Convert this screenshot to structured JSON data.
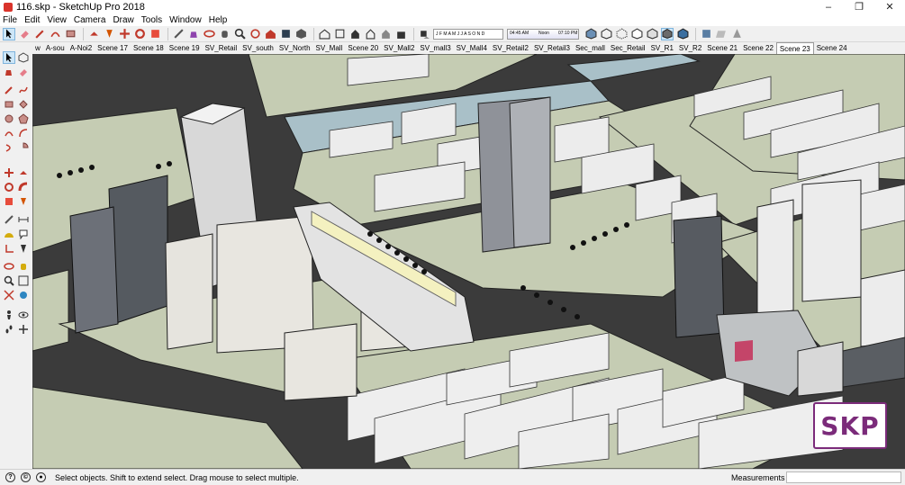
{
  "window": {
    "title": "116.skp - SketchUp Pro 2018",
    "minimize": "–",
    "maximize": "❐",
    "close": "✕"
  },
  "menu": [
    "File",
    "Edit",
    "View",
    "Camera",
    "Draw",
    "Tools",
    "Window",
    "Help"
  ],
  "toolbar": {
    "shadow_months": "J F M A M J J A S O N D",
    "time_start": "04:45 AM",
    "time_noon": "Noon",
    "time_end": "07:10 PM"
  },
  "scenes": [
    "w",
    "A-sou",
    "A-Noi2",
    "Scene 17",
    "Scene 18",
    "Scene 19",
    "SV_Retail",
    "SV_south",
    "SV_North",
    "SV_Mall",
    "Scene 20",
    "SV_Mall2",
    "SV_mall3",
    "SV_Mall4",
    "SV_Retail2",
    "SV_Retail3",
    "Sec_mall",
    "Sec_Retail",
    "SV_R1",
    "SV_R2",
    "Scene 21",
    "Scene 22",
    "Scene 23",
    "Scene 24"
  ],
  "active_scene": "Scene 23",
  "logo": "SKP",
  "status": {
    "hint": "Select objects. Shift to extend select. Drag mouse to select multiple.",
    "measurements_label": "Measurements",
    "measurements_value": ""
  },
  "colors": {
    "road": "#3b3b3b",
    "grass": "#c5ccb3",
    "water": "#a9c0c8",
    "building": "#ececec",
    "logo": "#7b2b7a"
  }
}
